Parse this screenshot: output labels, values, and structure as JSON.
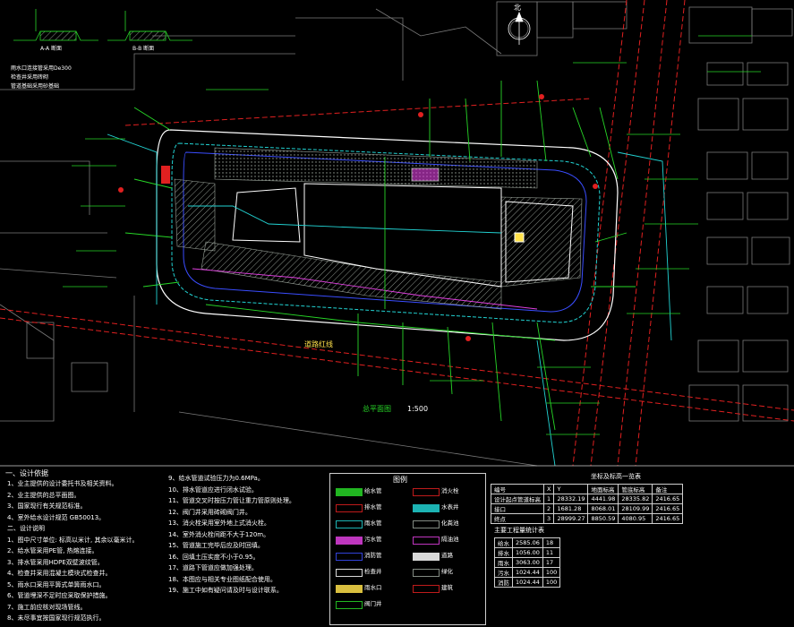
{
  "colors": {
    "background": "#000000",
    "site_outline": "#ffffff",
    "grass_hatch": "#9aa39a",
    "pipe_green": "#27d627",
    "pipe_cyan": "#22d3d3",
    "pipe_magenta": "#e040e0",
    "road_red": "#e02020",
    "pipe_blue": "#3a4dff",
    "text_yellow": "#ffe14a",
    "annotation_white": "#ffffff"
  },
  "drawing": {
    "north_label": "北",
    "plan_title": "总平面图",
    "plan_scale": "1:500",
    "road_note": "道路红线",
    "section_a": "A-A 断面",
    "section_b": "B-B 断面",
    "top_note_1": "雨水口连接管采用De300",
    "top_note_2": "检查井采用砖砌",
    "top_note_3": "管道基础采用砂基础"
  },
  "notes": {
    "heading": "一、设计依据",
    "lines_left": [
      "1、业主提供的设计委托书及相关资料。",
      "2、业主提供的总平面图。",
      "3、国家现行有关规范标准。",
      "4、室外给水设计规范 GB50013。",
      "二、设计说明",
      "1、图中尺寸单位: 标高以米计, 其余以毫米计。",
      "2、给水管采用PE管, 热熔连接。",
      "3、排水管采用HDPE双壁波纹管。",
      "4、检查井采用混凝土模块式检查井。",
      "5、雨水口采用平箅式单箅雨水口。",
      "6、管道埋深不足时应采取保护措施。",
      "7、施工前应核对现场管线。",
      "8、未尽事宜按国家现行规范执行。"
    ],
    "lines_mid": [
      "9、给水管道试验压力为0.6MPa。",
      "10、排水管道应进行闭水试验。",
      "11、管道交叉时按压力管让重力管原则处理。",
      "12、阀门井采用砖砌阀门井。",
      "13、消火栓采用室外地上式消火栓。",
      "14、室外消火栓间距不大于120m。",
      "15、管道施工完毕后应及时回填。",
      "16、回填土压实度不小于0.95。",
      "17、道路下管道应做加强处理。",
      "18、本图应与相关专业图纸配合使用。",
      "19、施工中如有疑问请及时与设计联系。"
    ]
  },
  "legend": {
    "title": "图例",
    "items": [
      "给水管",
      "排水管",
      "雨水管",
      "污水管",
      "消防管",
      "检查井",
      "雨水口",
      "阀门井",
      "消火栓",
      "水表井",
      "化粪池",
      "隔油池",
      "道路",
      "绿化",
      "建筑"
    ]
  },
  "coord_table": {
    "title": "坐标及标高一览表",
    "headers": [
      "编号",
      "X",
      "Y",
      "地面标高",
      "管底标高",
      "备注"
    ],
    "rows": [
      [
        "设计起点管道标高",
        "1",
        "28332.19",
        "4441.98",
        "28335.82",
        "2416.65"
      ],
      [
        "接口",
        "2",
        "1681.28",
        "8068.01",
        "28109.99",
        "2416.65"
      ],
      [
        "终点",
        "3",
        "28999.27",
        "8850.59",
        "4080.95",
        "2416.65"
      ]
    ]
  },
  "small_table": {
    "title": "主要工程量统计表",
    "rows": [
      [
        "给水",
        "2585.06",
        "18"
      ],
      [
        "排水",
        "1056.00",
        "11"
      ],
      [
        "雨水",
        "3063.00",
        "17"
      ],
      [
        "污水",
        "1024.44",
        "100"
      ],
      [
        "消防",
        "1024.44",
        "100"
      ]
    ]
  }
}
